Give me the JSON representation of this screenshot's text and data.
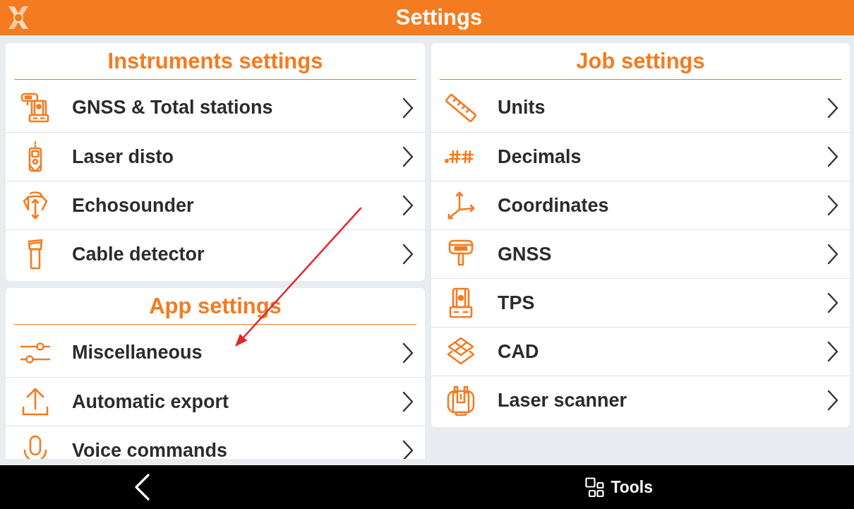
{
  "title_bar": {
    "title": "Settings"
  },
  "left_column": [
    {
      "title": "Instruments settings",
      "items": [
        {
          "label": "GNSS & Total stations"
        },
        {
          "label": "Laser disto"
        },
        {
          "label": "Echosounder"
        },
        {
          "label": "Cable detector"
        }
      ]
    },
    {
      "title": "App settings",
      "items": [
        {
          "label": "Miscellaneous"
        },
        {
          "label": "Automatic export"
        },
        {
          "label": "Voice commands"
        }
      ]
    }
  ],
  "right_column": [
    {
      "title": "Job settings",
      "items": [
        {
          "label": "Units"
        },
        {
          "label": "Decimals"
        },
        {
          "label": "Coordinates"
        },
        {
          "label": "GNSS"
        },
        {
          "label": "TPS"
        },
        {
          "label": "CAD"
        },
        {
          "label": "Laser scanner"
        }
      ]
    }
  ],
  "bottom_bar": {
    "tools_label": "Tools"
  }
}
